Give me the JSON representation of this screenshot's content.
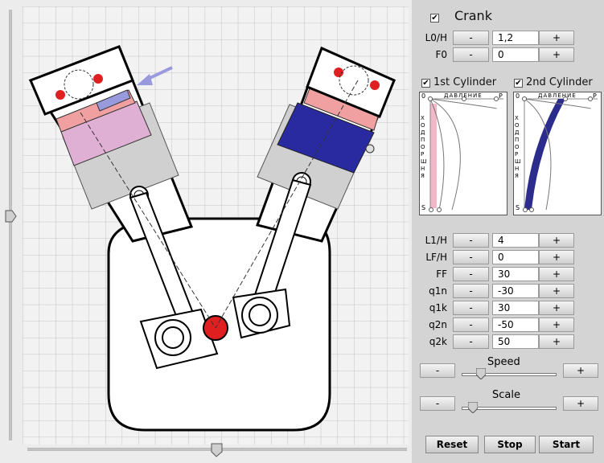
{
  "crank": {
    "checked": true,
    "check_mark": "✔",
    "title": "Crank"
  },
  "top_params": [
    {
      "label": "L0/H",
      "value": "1,2"
    },
    {
      "label": "F0",
      "value": "0"
    }
  ],
  "cylinders": [
    {
      "title": "1st Cylinder",
      "checked": true,
      "check_mark": "✔",
      "color": "#e0a8cc"
    },
    {
      "title": "2nd Cylinder",
      "checked": true,
      "check_mark": "✔",
      "color": "#2c2c8c"
    }
  ],
  "graph_labels": {
    "top": "ДАВЛЕНИЕ",
    "left": "ХОД ПОРШНЯ",
    "corner_tl": "0",
    "corner_tr": "P",
    "corner_bl": "S"
  },
  "params": [
    {
      "label": "L1/H",
      "value": "4"
    },
    {
      "label": "LF/H",
      "value": "0"
    },
    {
      "label": "FF",
      "value": "30"
    },
    {
      "label": "q1n",
      "value": "-30"
    },
    {
      "label": "q1k",
      "value": "30"
    },
    {
      "label": "q2n",
      "value": "-50"
    },
    {
      "label": "q2k",
      "value": "50"
    }
  ],
  "minus": "-",
  "plus": "+",
  "speed": {
    "label": "Speed",
    "level": 0.2
  },
  "scale": {
    "label": "Scale",
    "level": 0.12
  },
  "buttons": {
    "reset": "Reset",
    "stop": "Stop",
    "start": "Start"
  },
  "colors": {
    "cylinder1": "#e0b0d4",
    "cylinder2": "#2a2aa0",
    "crank_pin": "#e02020",
    "arrow": "#9999dd"
  }
}
